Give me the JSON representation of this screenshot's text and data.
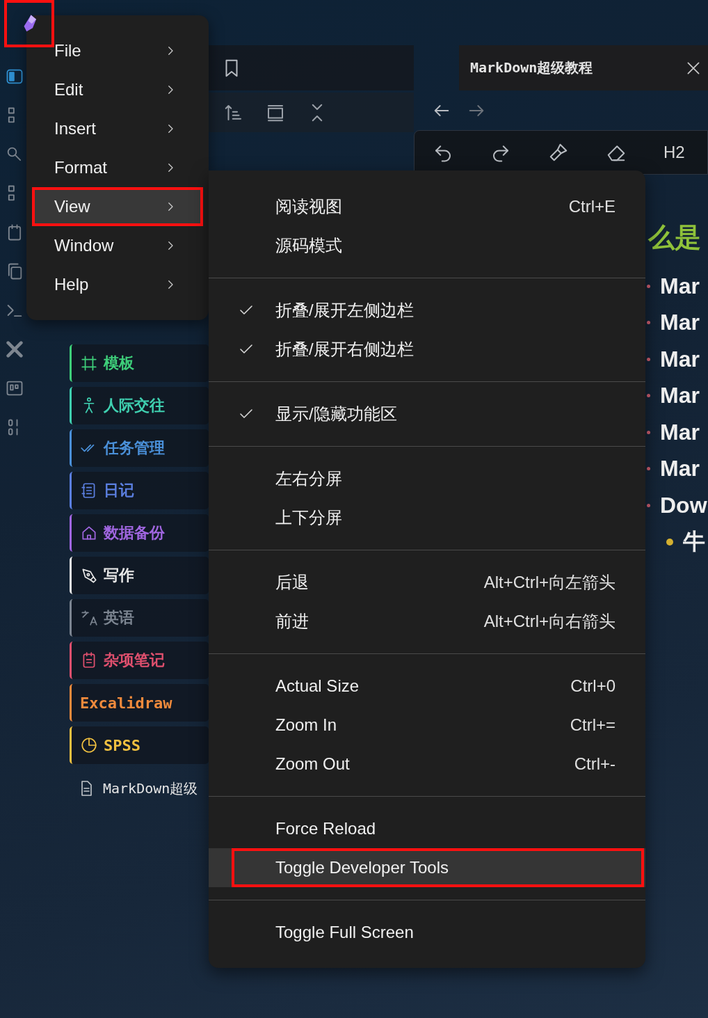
{
  "app_logo": {
    "highlighted": true
  },
  "tab": {
    "title": "MarkDown超级教程"
  },
  "editor_toolbar": {
    "heading_button": "H2"
  },
  "file_tree": {
    "folders": [
      {
        "label": "模板",
        "color": "#3ecf7a"
      },
      {
        "label": "人际交往",
        "color": "#3fd0b0"
      },
      {
        "label": "任务管理",
        "color": "#4a90d9"
      },
      {
        "label": "日记",
        "color": "#5b7fe0"
      },
      {
        "label": "数据备份",
        "color": "#a066e0"
      },
      {
        "label": "写作",
        "color": "#e8e8e8"
      },
      {
        "label": "英语",
        "color": "#7c8591"
      },
      {
        "label": "杂项笔记",
        "color": "#e0506e"
      },
      {
        "label": "Excalidraw",
        "color": "#f08a3c"
      },
      {
        "label": "SPSS",
        "color": "#f0c040"
      }
    ],
    "files": [
      {
        "label": "MarkDown超级"
      }
    ]
  },
  "editor": {
    "heading": "么是",
    "bullets": [
      {
        "text": "Mar"
      },
      {
        "text": "Mar"
      },
      {
        "text": "Mar"
      },
      {
        "text": "Mar"
      },
      {
        "text": "Mar"
      },
      {
        "text": "Mar"
      },
      {
        "text": "Dow",
        "children": [
          {
            "text": "牛"
          }
        ]
      }
    ]
  },
  "main_menu": {
    "items": [
      {
        "label": "File",
        "selected": false,
        "highlighted": false
      },
      {
        "label": "Edit",
        "selected": false,
        "highlighted": false
      },
      {
        "label": "Insert",
        "selected": false,
        "highlighted": false
      },
      {
        "label": "Format",
        "selected": false,
        "highlighted": false
      },
      {
        "label": "View",
        "selected": true,
        "highlighted": true
      },
      {
        "label": "Window",
        "selected": false,
        "highlighted": false
      },
      {
        "label": "Help",
        "selected": false,
        "highlighted": false
      }
    ]
  },
  "view_submenu": {
    "groups": [
      {
        "items": [
          {
            "label": "阅读视图",
            "shortcut": "Ctrl+E",
            "checked": false,
            "selected": false,
            "highlighted": false
          },
          {
            "label": "源码模式",
            "checked": false,
            "selected": false,
            "highlighted": false
          }
        ]
      },
      {
        "items": [
          {
            "label": "折叠/展开左侧边栏",
            "checked": true,
            "selected": false,
            "highlighted": false
          },
          {
            "label": "折叠/展开右侧边栏",
            "checked": true,
            "selected": false,
            "highlighted": false
          }
        ]
      },
      {
        "items": [
          {
            "label": "显示/隐藏功能区",
            "checked": true,
            "selected": false,
            "highlighted": false
          }
        ]
      },
      {
        "items": [
          {
            "label": "左右分屏",
            "checked": false,
            "selected": false,
            "highlighted": false
          },
          {
            "label": "上下分屏",
            "checked": false,
            "selected": false,
            "highlighted": false
          }
        ]
      },
      {
        "items": [
          {
            "label": "后退",
            "shortcut": "Alt+Ctrl+向左箭头",
            "checked": false,
            "selected": false,
            "highlighted": false
          },
          {
            "label": "前进",
            "shortcut": "Alt+Ctrl+向右箭头",
            "checked": false,
            "selected": false,
            "highlighted": false
          }
        ]
      },
      {
        "items": [
          {
            "label": "Actual Size",
            "shortcut": "Ctrl+0",
            "checked": false,
            "selected": false,
            "highlighted": false
          },
          {
            "label": "Zoom In",
            "shortcut": "Ctrl+=",
            "checked": false,
            "selected": false,
            "highlighted": false
          },
          {
            "label": "Zoom Out",
            "shortcut": "Ctrl+-",
            "checked": false,
            "selected": false,
            "highlighted": false
          }
        ]
      },
      {
        "items": [
          {
            "label": "Force Reload",
            "checked": false,
            "selected": false,
            "highlighted": false
          },
          {
            "label": "Toggle Developer Tools",
            "checked": false,
            "selected": true,
            "highlighted": true
          }
        ]
      },
      {
        "items": [
          {
            "label": "Toggle Full Screen",
            "checked": false,
            "selected": false,
            "highlighted": false
          }
        ]
      }
    ]
  }
}
